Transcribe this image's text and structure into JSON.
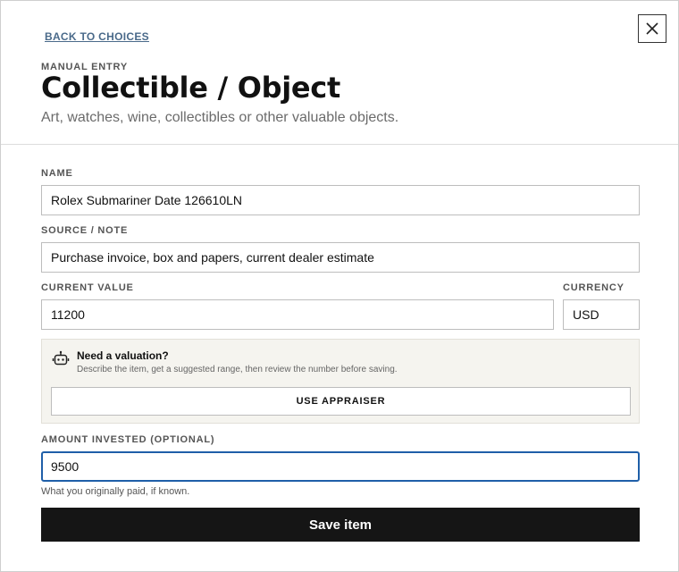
{
  "header": {
    "back_link": "BACK TO CHOICES",
    "eyebrow": "MANUAL ENTRY",
    "title": "Collectible / Object",
    "subtitle": "Art, watches, wine, collectibles or other valuable objects."
  },
  "form": {
    "name": {
      "label": "NAME",
      "value": "Rolex Submariner Date 126610LN"
    },
    "source": {
      "label": "SOURCE / NOTE",
      "value": "Purchase invoice, box and papers, current dealer estimate"
    },
    "current_value": {
      "label": "CURRENT VALUE",
      "value": "11200"
    },
    "currency": {
      "label": "CURRENCY",
      "value": "USD"
    },
    "valuation": {
      "icon": "robot-icon",
      "title": "Need a valuation?",
      "description": "Describe the item, get a suggested range, then review the number before saving.",
      "button_label": "USE APPRAISER"
    },
    "amount_invested": {
      "label": "AMOUNT INVESTED (OPTIONAL)",
      "value": "9500",
      "help": "What you originally paid, if known."
    },
    "save_label": "Save item"
  },
  "colors": {
    "accent_focus": "#1f5fa8",
    "link": "#4a6a8a",
    "primary_button": "#151515",
    "panel_bg": "#f5f4ef"
  }
}
